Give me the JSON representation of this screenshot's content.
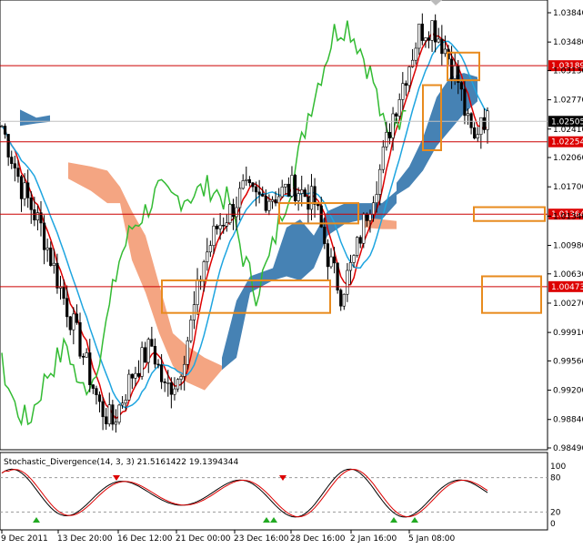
{
  "chart": {
    "price_axis": [
      "1.03840",
      "1.03480",
      "1.03130",
      "1.02770",
      "1.02410",
      "1.02060",
      "1.01700",
      "1.01340",
      "1.00980",
      "1.00630",
      "1.00270",
      "0.99910",
      "0.99560",
      "0.99200",
      "0.98840",
      "0.98490"
    ],
    "price_min": 0.9849,
    "price_max": 1.0384,
    "horizontal_levels": [
      {
        "value": 1.03189,
        "label": "1.03189"
      },
      {
        "value": 1.02254,
        "label": "1.02254"
      },
      {
        "value": 1.01364,
        "label": "1.01364"
      },
      {
        "value": 1.00473,
        "label": "1.00473"
      }
    ],
    "current_price": {
      "value": 1.02505,
      "label": "1.02505"
    },
    "time_axis": [
      "9 Dec 2011",
      "13 Dec 20:00",
      "16 Dec 12:00",
      "21 Dec 00:00",
      "23 Dec 16:00",
      "28 Dec 16:00",
      "2 Jan 16:00",
      "5 Jan 08:00"
    ],
    "colors": {
      "level_line": "#cc0000",
      "level_label_bg": "#dd0000",
      "current_label_bg": "#000000",
      "box": "#e88b1e",
      "cloud_bull": "#4682b4",
      "cloud_bear": "#f4a582",
      "tenkan": "#dd0000",
      "kijun": "#1ea5e0",
      "chikou": "#33bb33",
      "stoch_main": "#000000",
      "stoch_signal": "#dd0000",
      "arrow_up": "#22aa22",
      "arrow_down": "#dd0000"
    }
  },
  "indicator": {
    "title": "Stochastic_Divergence(14, 3, 3) 21.5161422 19.1394344",
    "levels": [
      "100",
      "80",
      "20",
      "0"
    ]
  }
}
